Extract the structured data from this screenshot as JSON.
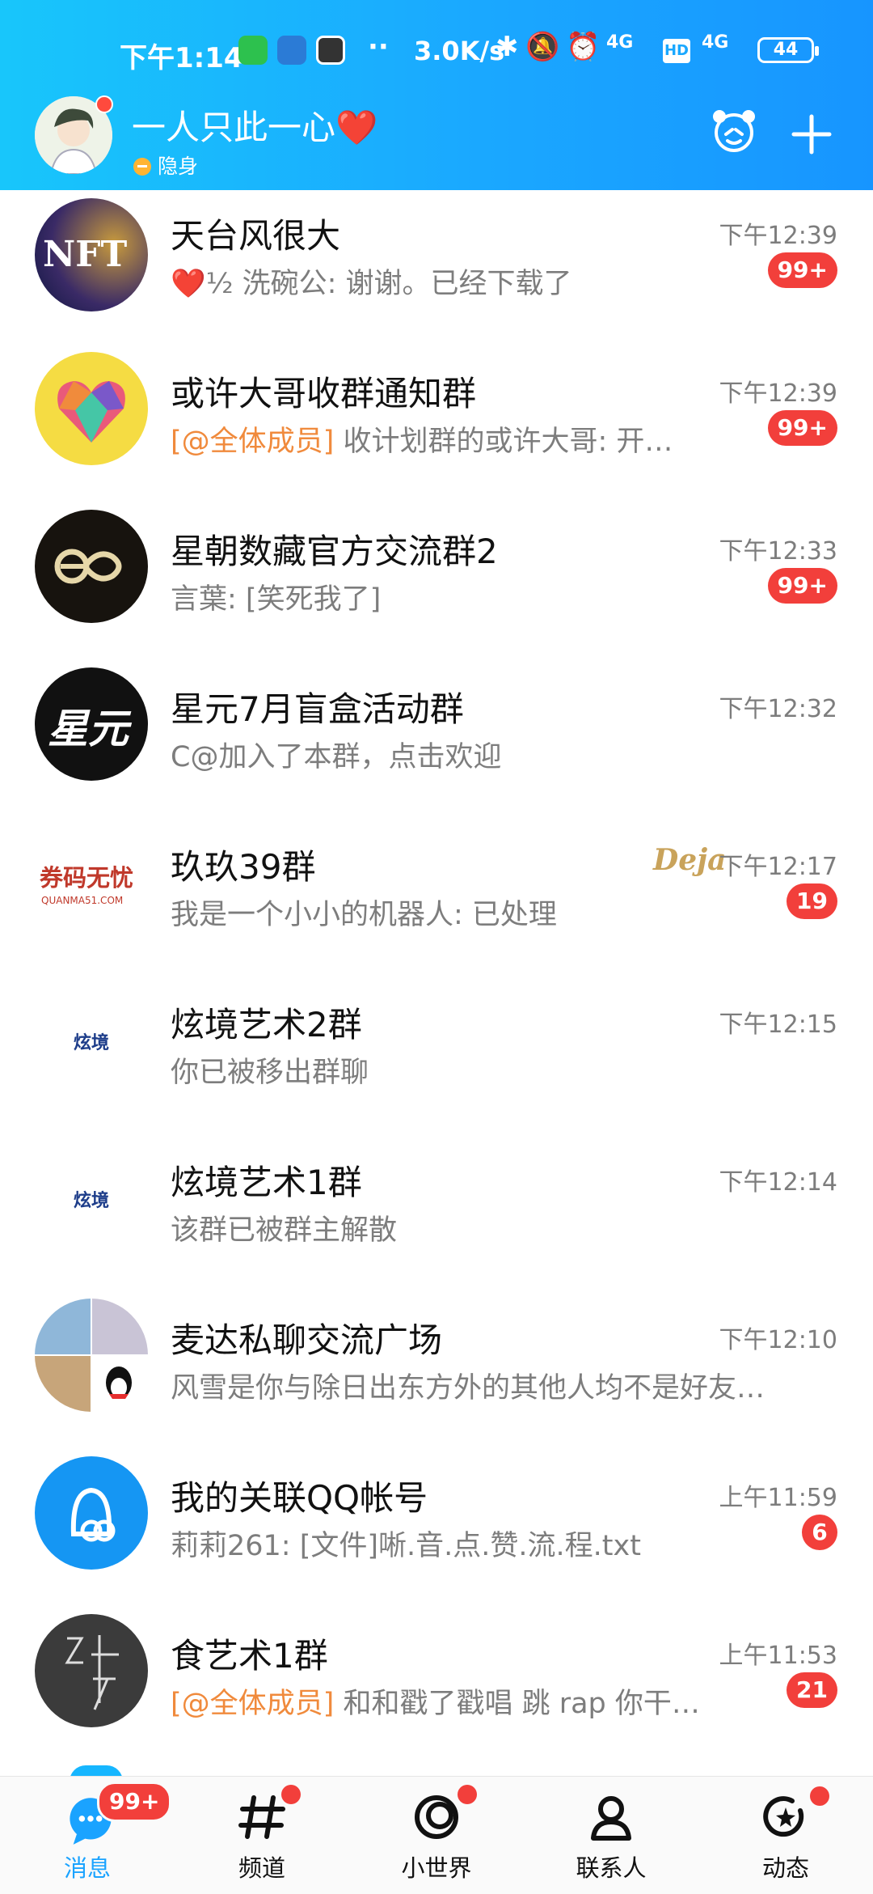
{
  "status_bar": {
    "time": "下午1:14",
    "dots": "··",
    "net_speed": "3.0K/s",
    "sig1": "4G",
    "hd": "HD",
    "sig2": "4G",
    "battery": "44"
  },
  "header": {
    "nickname": "一人只此一心❤️",
    "status": "隐身"
  },
  "chats": [
    {
      "title": "天台风很大",
      "preview": "❤️½ 洗碗公: 谢谢。已经下载了",
      "mention": "",
      "time": "下午12:39",
      "badge": "99+"
    },
    {
      "title": "或许大哥收群通知群",
      "preview": "收计划群的或许大哥: 开…",
      "mention": "[@全体成员]",
      "time": "下午12:39",
      "badge": "99+"
    },
    {
      "title": "星朝数藏官方交流群2",
      "preview": "言葉: [笑死我了]",
      "mention": "",
      "time": "下午12:33",
      "badge": "99+"
    },
    {
      "title": "星元7月盲盒活动群",
      "preview": "C@加入了本群，点击欢迎",
      "mention": "",
      "time": "下午12:32",
      "badge": ""
    },
    {
      "title": "玖玖39群",
      "preview": "我是一个小小的机器人: 已处理",
      "mention": "",
      "time": "下午12:17",
      "badge": "19",
      "tag": "Deja"
    },
    {
      "title": "炫境艺术2群",
      "preview": "你已被移出群聊",
      "mention": "",
      "time": "下午12:15",
      "badge": ""
    },
    {
      "title": "炫境艺术1群",
      "preview": "该群已被群主解散",
      "mention": "",
      "time": "下午12:14",
      "badge": ""
    },
    {
      "title": "麦达私聊交流广场",
      "preview": "风雪是你与除日出东方外的其他人均不是好友…",
      "mention": "",
      "time": "下午12:10",
      "badge": ""
    },
    {
      "title": "我的关联QQ帐号",
      "preview": "莉莉261: [文件]唽.音.点.赞.流.程.txt",
      "mention": "",
      "time": "上午11:59",
      "badge": "6"
    },
    {
      "title": "食艺术1群",
      "preview": "和和戳了戳唱 跳 rap 你干…",
      "mention": "[@全体成员]",
      "time": "上午11:53",
      "badge": "21"
    }
  ],
  "avatar_text": {
    "nft": "NFT",
    "xingyuan": "星元",
    "quanma": "券码无忧",
    "quanma_url": "QUANMA51.COM",
    "xuanjing": "炫境"
  },
  "nav": {
    "tabs": [
      {
        "label": "消息",
        "icon": "message-icon"
      },
      {
        "label": "频道",
        "icon": "channel-icon"
      },
      {
        "label": "小世界",
        "icon": "small-world-icon"
      },
      {
        "label": "联系人",
        "icon": "contacts-icon"
      },
      {
        "label": "动态",
        "icon": "feed-icon"
      }
    ],
    "message_badge": "99+"
  },
  "colors": {
    "header_gradient_start": "#18c6fb",
    "header_gradient_end": "#1795ff",
    "badge_red": "#f23f3b",
    "mention_orange": "#f08a3c",
    "active_tab_blue": "#1aa3ff"
  }
}
